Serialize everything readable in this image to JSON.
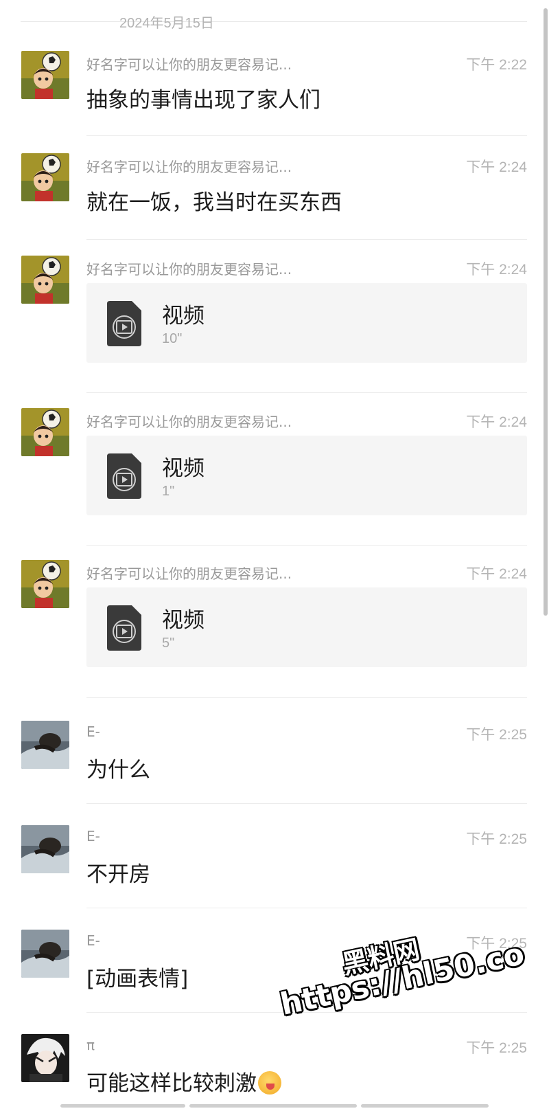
{
  "date_divider": "2024年5月15日",
  "colors": {
    "background": "#ffffff",
    "secondary_text": "#999999",
    "time_text": "#b5b5b5",
    "card_bg": "#f5f5f5"
  },
  "messages": [
    {
      "sender": "好名字可以让你的朋友更容易记...",
      "time": "下午 2:22",
      "text": "抽象的事情出现了家人们",
      "avatar": "avatar-football-boy"
    },
    {
      "sender": "好名字可以让你的朋友更容易记...",
      "time": "下午 2:24",
      "text": "就在一饭，我当时在买东西",
      "avatar": "avatar-football-boy"
    },
    {
      "sender": "好名字可以让你的朋友更容易记...",
      "time": "下午 2:24",
      "video": {
        "title": "视频",
        "duration": "10\""
      },
      "avatar": "avatar-football-boy"
    },
    {
      "sender": "好名字可以让你的朋友更容易记...",
      "time": "下午 2:24",
      "video": {
        "title": "视频",
        "duration": "1\""
      },
      "avatar": "avatar-football-boy"
    },
    {
      "sender": "好名字可以让你的朋友更容易记...",
      "time": "下午 2:24",
      "video": {
        "title": "视频",
        "duration": "5\""
      },
      "avatar": "avatar-football-boy"
    },
    {
      "sender": "E-",
      "time": "下午 2:25",
      "text": "为什么",
      "avatar": "avatar-dark-photo"
    },
    {
      "sender": "E-",
      "time": "下午 2:25",
      "text": "不开房",
      "avatar": "avatar-dark-photo"
    },
    {
      "sender": "E-",
      "time": "下午 2:25",
      "text": "[动画表情]",
      "avatar": "avatar-dark-photo"
    },
    {
      "sender": "π",
      "time": "下午 2:25",
      "text": "可能这样比较刺激",
      "emoji": "blushing-face-emoji",
      "avatar": "avatar-anime-white-hair"
    }
  ],
  "watermark": {
    "line1": "黑料网",
    "line2": "https://hl50.co"
  }
}
